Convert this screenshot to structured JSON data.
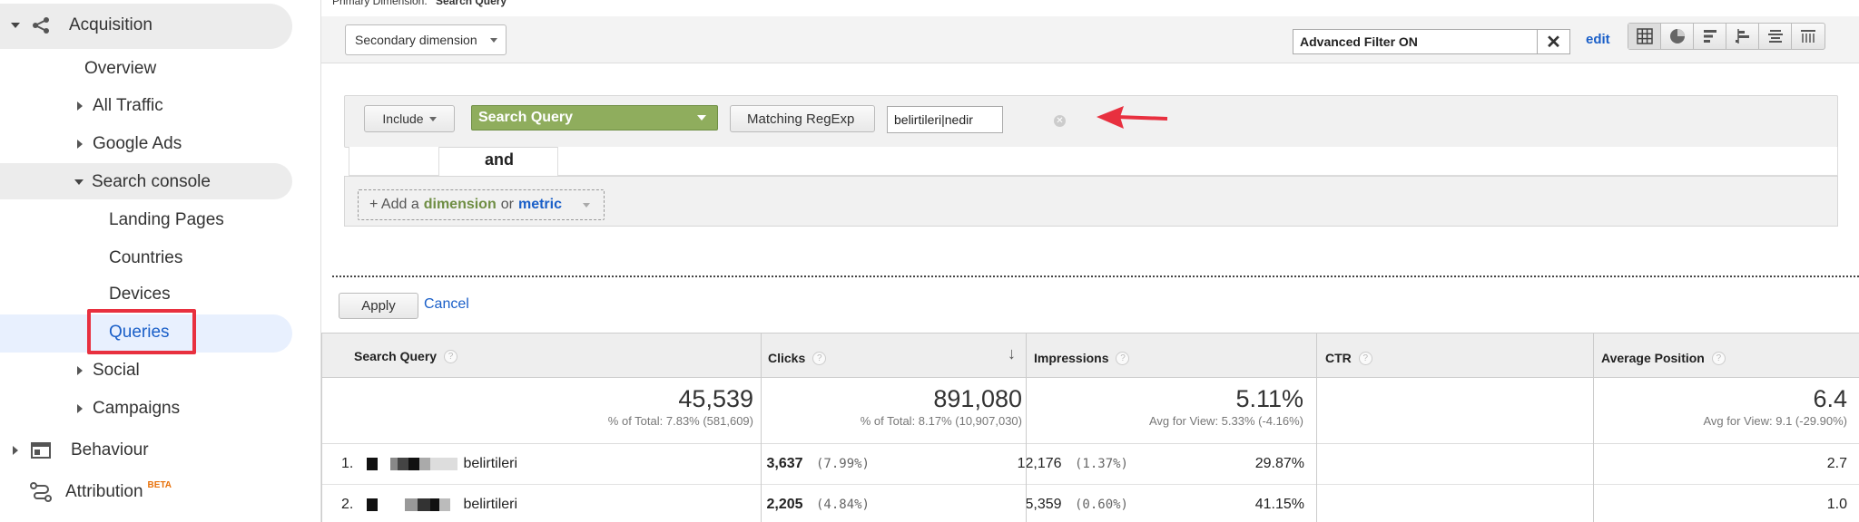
{
  "sidebar": {
    "acquisition": "Acquisition",
    "overview": "Overview",
    "all_traffic": "All Traffic",
    "google_ads": "Google Ads",
    "search_console": "Search console",
    "landing_pages": "Landing Pages",
    "countries": "Countries",
    "devices": "Devices",
    "queries": "Queries",
    "social": "Social",
    "campaigns": "Campaigns",
    "behaviour": "Behaviour",
    "attribution": "Attribution",
    "attribution_badge": "BETA"
  },
  "header": {
    "primary_dimension_label": "Primary Dimension:",
    "primary_dimension_value": "Search Query"
  },
  "toolbar": {
    "secondary_dimension": "Secondary dimension",
    "advanced_filter": "Advanced Filter ON",
    "edit": "edit"
  },
  "filter": {
    "include": "Include",
    "dimension": "Search Query",
    "match_type": "Matching RegExp",
    "value": "belirtileri|nedir",
    "and_label": "and",
    "add_prefix": "+ Add a",
    "add_dimension": "dimension",
    "add_or": "or",
    "add_metric": "metric"
  },
  "actions": {
    "apply": "Apply",
    "cancel": "Cancel"
  },
  "table": {
    "headers": [
      "Search Query",
      "Clicks",
      "Impressions",
      "CTR",
      "Average Position"
    ],
    "totals": {
      "clicks": "45,539",
      "clicks_sub": "% of Total: 7.83% (581,609)",
      "impressions": "891,080",
      "impressions_sub": "% of Total: 8.17% (10,907,030)",
      "ctr": "5.11%",
      "ctr_sub": "Avg for View: 5.33% (-4.16%)",
      "position": "6.4",
      "position_sub": "Avg for View: 9.1 (-29.90%)"
    },
    "rows": [
      {
        "index": "1.",
        "query": "belirtileri",
        "clicks": "3,637",
        "clicks_pct": "(7.99%)",
        "impressions": "12,176",
        "impressions_pct": "(1.37%)",
        "ctr": "29.87%",
        "position": "2.7"
      },
      {
        "index": "2.",
        "query": "belirtileri",
        "clicks": "2,205",
        "clicks_pct": "(4.84%)",
        "impressions": "5,359",
        "impressions_pct": "(0.60%)",
        "ctr": "41.15%",
        "position": "1.0"
      }
    ]
  },
  "colors": {
    "accent_blue": "#1a5fc8",
    "dimension_green": "#8fad5d",
    "highlight_red": "#e8303f"
  }
}
